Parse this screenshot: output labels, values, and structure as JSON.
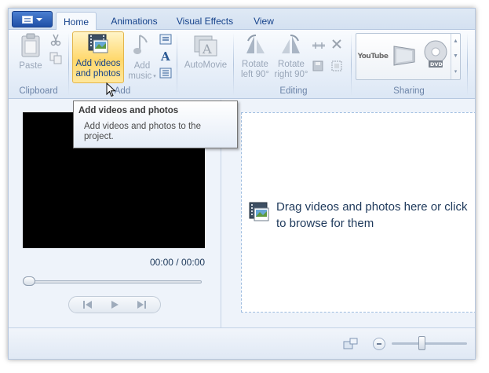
{
  "ribbon": {
    "tabs": [
      {
        "label": "Home",
        "active": true
      },
      {
        "label": "Animations",
        "active": false
      },
      {
        "label": "Visual Effects",
        "active": false
      },
      {
        "label": "View",
        "active": false
      }
    ],
    "clipboard": {
      "paste": "Paste",
      "group": "Clipboard"
    },
    "add": {
      "add_videos_line1": "Add videos",
      "add_videos_line2": "and photos",
      "add_music_line1": "Add",
      "add_music_line2": "music",
      "group": "Add"
    },
    "automovie": {
      "label": "AutoMovie"
    },
    "editing": {
      "rotate_left_line1": "Rotate",
      "rotate_left_line2": "left 90°",
      "rotate_right_line1": "Rotate",
      "rotate_right_line2": "right 90°",
      "group": "Editing"
    },
    "sharing": {
      "youtube": "YouTube",
      "dvd": "DVD",
      "group": "Sharing"
    }
  },
  "tooltip": {
    "title": "Add videos and photos",
    "body": "Add videos and photos to the project."
  },
  "preview": {
    "timecode": "00:00 / 00:00",
    "progress": 0
  },
  "storyboard": {
    "line1": "Drag videos and photos here or click",
    "line2": "to browse for them"
  },
  "colors": {
    "accent": "#15428b",
    "highlight": "#ffd86b",
    "window_bg": "#eef3fa"
  }
}
